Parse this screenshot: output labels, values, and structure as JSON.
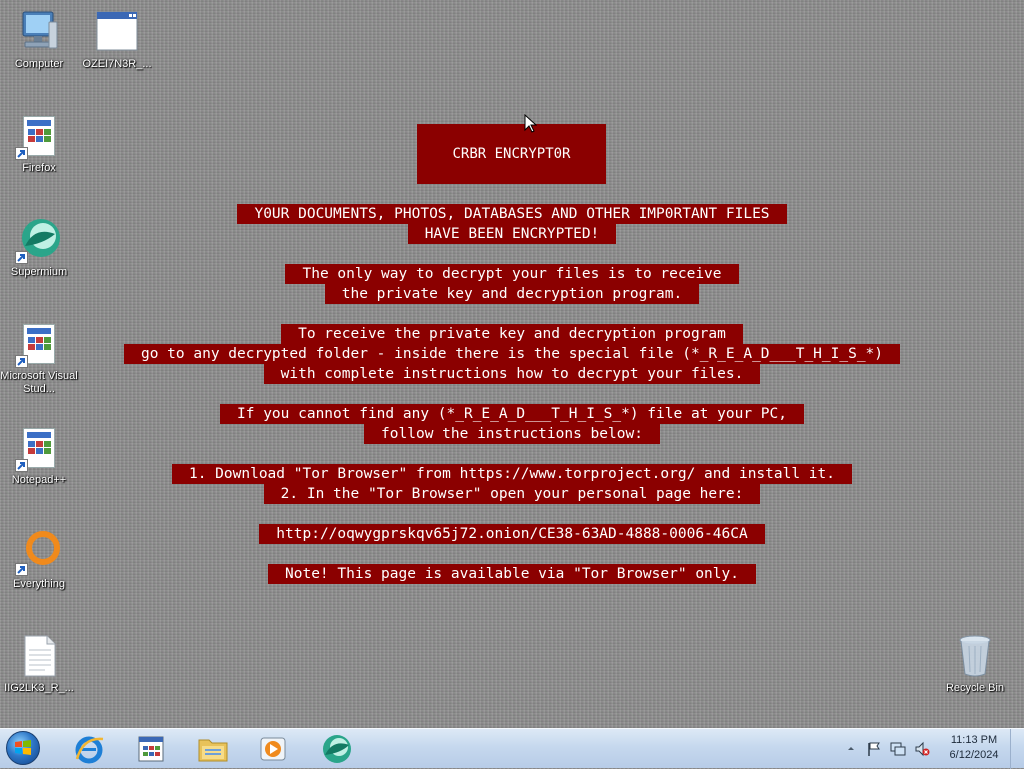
{
  "desktop": {
    "icons": [
      {
        "label": "Computer"
      },
      {
        "label": "OZEI7N3R_..."
      },
      {
        "label": "Firefox"
      },
      {
        "label": "Supermium"
      },
      {
        "label": "Microsoft Visual Stud..."
      },
      {
        "label": "Notepad++"
      },
      {
        "label": "Everything"
      },
      {
        "label": "IIG2LK3_R_..."
      },
      {
        "label": "Recycle Bin"
      }
    ]
  },
  "ransom_note": {
    "title": "CRBR ENCRYPT0R",
    "lines": [
      "Y0UR DOCUMENTS, PHOTOS, DATABASES AND OTHER IMP0RTANT FILES",
      "HAVE BEEN ENCRYPTED!",
      "The only way to decrypt your files is to receive",
      "the private key and decryption program.",
      "To receive the private key and decryption program",
      "go to any decrypted folder - inside there is the special file (*_R_E_A_D___T_H_I_S_*)",
      "with complete instructions how to decrypt your files.",
      "If you cannot find any (*_R_E_A_D___T_H_I_S_*) file at your PC,",
      "follow the instructions below:",
      "1. Download \"Tor Browser\" from https://www.torproject.org/ and install it.",
      "2. In the \"Tor Browser\" open your personal page here:",
      "http://oqwygprskqv65j72.onion/CE38-63AD-4888-0006-46CA",
      "Note! This page is available via \"Tor Browser\" only."
    ]
  },
  "taskbar": {
    "start_icon": "windows-start-orb",
    "pinned": [
      "internet-explorer-icon",
      "app-window-icon",
      "file-explorer-icon",
      "media-player-icon",
      "supermium-icon"
    ],
    "tray_icons": [
      "show-hidden-icons-arrow",
      "action-center-flag-icon",
      "network-icon",
      "volume-muted-icon"
    ],
    "clock_time": "11:13 PM",
    "clock_date": "6/12/2024"
  },
  "colors": {
    "note_background": "#8b0000",
    "note_text": "#ffffff",
    "taskbar_top": "#dde9f6",
    "taskbar_bottom": "#b7cce7"
  }
}
